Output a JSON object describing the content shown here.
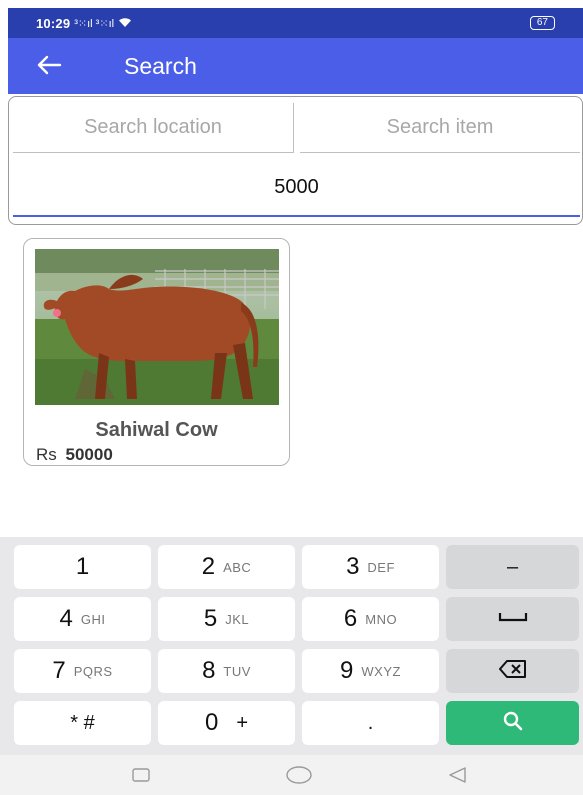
{
  "status_bar": {
    "time": "10:29",
    "signals": "³⁙ıl ³⁙ıl",
    "battery": "67"
  },
  "app_bar": {
    "back_icon": "arrow-left-icon",
    "title": "Search"
  },
  "search": {
    "location_placeholder": "Search location",
    "item_placeholder": "Search item",
    "price_value": "5000"
  },
  "results": [
    {
      "name": "Sahiwal Cow",
      "currency": "Rs",
      "price": "50000"
    }
  ],
  "keyboard": {
    "rows": [
      [
        {
          "main": "1",
          "sub": ""
        },
        {
          "main": "2",
          "sub": "ABC"
        },
        {
          "main": "3",
          "sub": "DEF"
        },
        {
          "main": "–",
          "sub": ""
        }
      ],
      [
        {
          "main": "4",
          "sub": "GHI"
        },
        {
          "main": "5",
          "sub": "JKL"
        },
        {
          "main": "6",
          "sub": "MNO"
        },
        {
          "main": "space-icon",
          "sub": ""
        }
      ],
      [
        {
          "main": "7",
          "sub": "PQRS"
        },
        {
          "main": "8",
          "sub": "TUV"
        },
        {
          "main": "9",
          "sub": "WXYZ"
        },
        {
          "main": "backspace-icon",
          "sub": ""
        }
      ],
      [
        {
          "main": "* #",
          "sub": ""
        },
        {
          "main": "0",
          "sub": "+"
        },
        {
          "main": ".",
          "sub": ""
        },
        {
          "main": "search-icon",
          "sub": ""
        }
      ]
    ],
    "go_color": "#2fb979"
  },
  "nav_bar": {
    "icons": [
      "recent-apps-icon",
      "home-icon",
      "back-triangle-icon"
    ]
  },
  "colors": {
    "app_bar": "#4b5ee8",
    "status_bar": "#2a3fae",
    "underline": "#4b5ee8"
  }
}
